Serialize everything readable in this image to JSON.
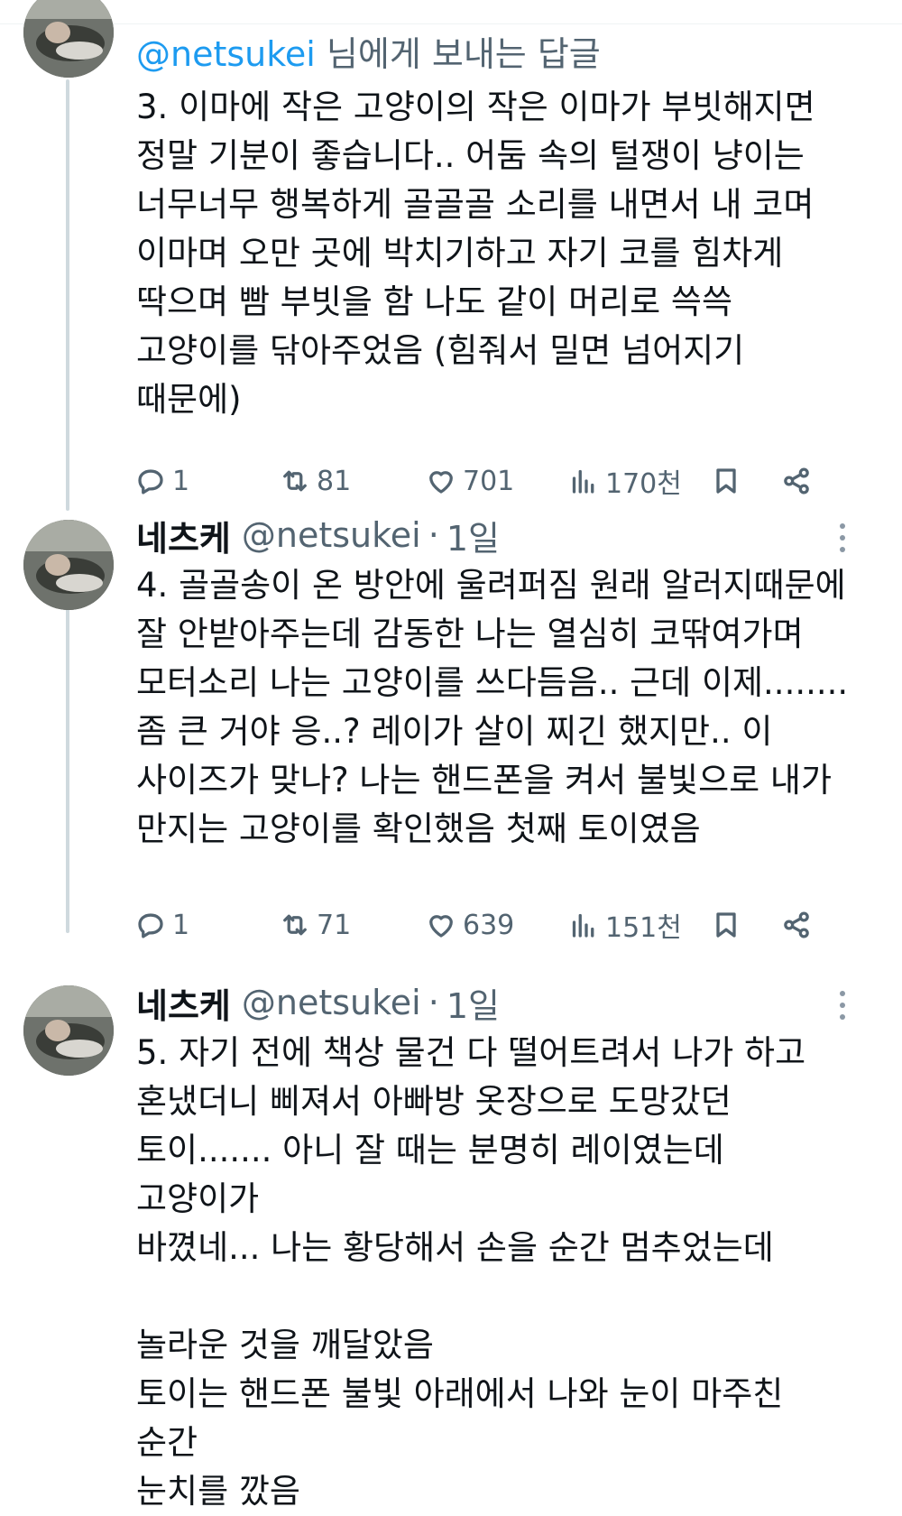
{
  "tweets": [
    {
      "reply_prefix": "@netsukei",
      "reply_suffix": " 님에게 보내는 답글",
      "text": "3. 이마에 작은 고양이의 작은 이마가 부빗해지면\n정말 기분이 좋습니다.. 어둠 속의 털쟁이 냥이는\n너무너무 행복하게 골골골 소리를 내면서 내 코며\n이마며 오만 곳에 박치기하고 자기 코를 힘차게\n딱으며 빰 부빗을 함 나도 같이 머리로 쓱쓱\n고양이를 닦아주었음 (힘줘서 밀면 넘어지기\n때문에)",
      "replies": "1",
      "retweets": "81",
      "likes": "701",
      "views": "170천"
    },
    {
      "display_name": "네츠케",
      "handle": "@netsukei",
      "dot": "·",
      "time": "1일",
      "text": "4. 골골송이 온 방안에 울려퍼짐 원래 알러지때문에\n잘 안받아주는데 감동한 나는 열심히 코딲여가며\n모터소리 나는 고양이를 쓰다듬음.. 근데 이제........\n좀 큰 거야 응..? 레이가 살이 찌긴 했지만.. 이\n사이즈가 맞나? 나는 핸드폰을 켜서 불빛으로 내가\n만지는 고양이를 확인했음 첫째 토이였음",
      "replies": "1",
      "retweets": "71",
      "likes": "639",
      "views": "151천"
    },
    {
      "display_name": "네츠케",
      "handle": "@netsukei",
      "dot": "·",
      "time": "1일",
      "text": "5. 자기 전에 책상 물건 다 떨어트려서 나가 하고\n혼냈더니 삐져서 아빠방 옷장으로 도망갔던\n토이....... 아니 잘 때는 분명히 레이였는데 고양이가\n바꼈네... 나는 황당해서 손을 순간 멈추었는데\n\n놀라운 것을 깨달았음\n토이는 핸드폰 불빛 아래에서 나와 눈이 마주친\n순간\n눈치를 깠음"
    }
  ],
  "icons": {
    "reply": "reply-icon",
    "retweet": "retweet-icon",
    "like": "like-icon",
    "views": "views-icon",
    "bookmark": "bookmark-icon",
    "share": "share-icon",
    "more": "more-icon"
  },
  "colors": {
    "mention": "#1d9bf0",
    "secondary_text": "#536471",
    "thread_line": "#cfd9de"
  }
}
